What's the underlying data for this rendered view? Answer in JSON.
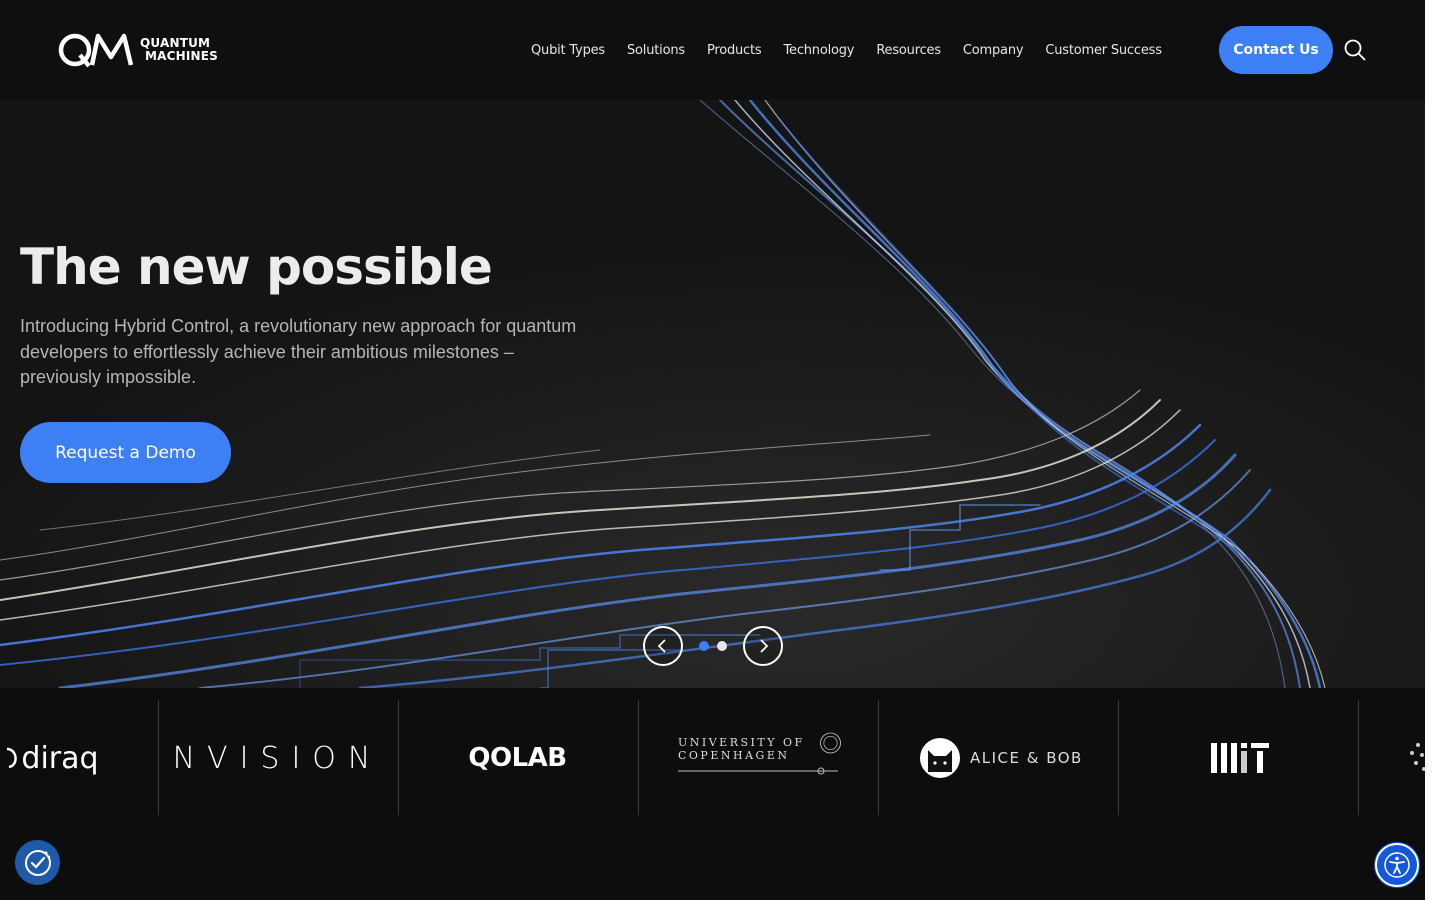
{
  "brand": {
    "name_line1": "QUANTUM",
    "name_line2": "MACHINES",
    "mark": "QM"
  },
  "nav": {
    "items": [
      {
        "label": "Qubit Types"
      },
      {
        "label": "Solutions"
      },
      {
        "label": "Products"
      },
      {
        "label": "Technology"
      },
      {
        "label": "Resources"
      },
      {
        "label": "Company"
      },
      {
        "label": "Customer Success"
      }
    ],
    "contact_label": "Contact Us",
    "search_icon": "search-icon"
  },
  "hero": {
    "title": "The new possible",
    "subtitle": "Introducing Hybrid Control, a revolutionary new approach for quantum developers to effortlessly achieve their ambitious milestones – previously impossible.",
    "cta_label": "Request a Demo",
    "slides_total": 2,
    "active_slide": 1
  },
  "partners": {
    "diraq": "diraq",
    "nvision": "NVISION",
    "qolab": "QOLAB",
    "copenhagen_line1": "UNIVERSITY OF",
    "copenhagen_line2": "COPENHAGEN",
    "alicebob": "ALICE & BOB",
    "mit": "MIT"
  },
  "colors": {
    "accent": "#3d7ff5",
    "background": "#0d0d0d",
    "header": "#0f0f0f",
    "accessibility_widget": "#1457d9"
  }
}
